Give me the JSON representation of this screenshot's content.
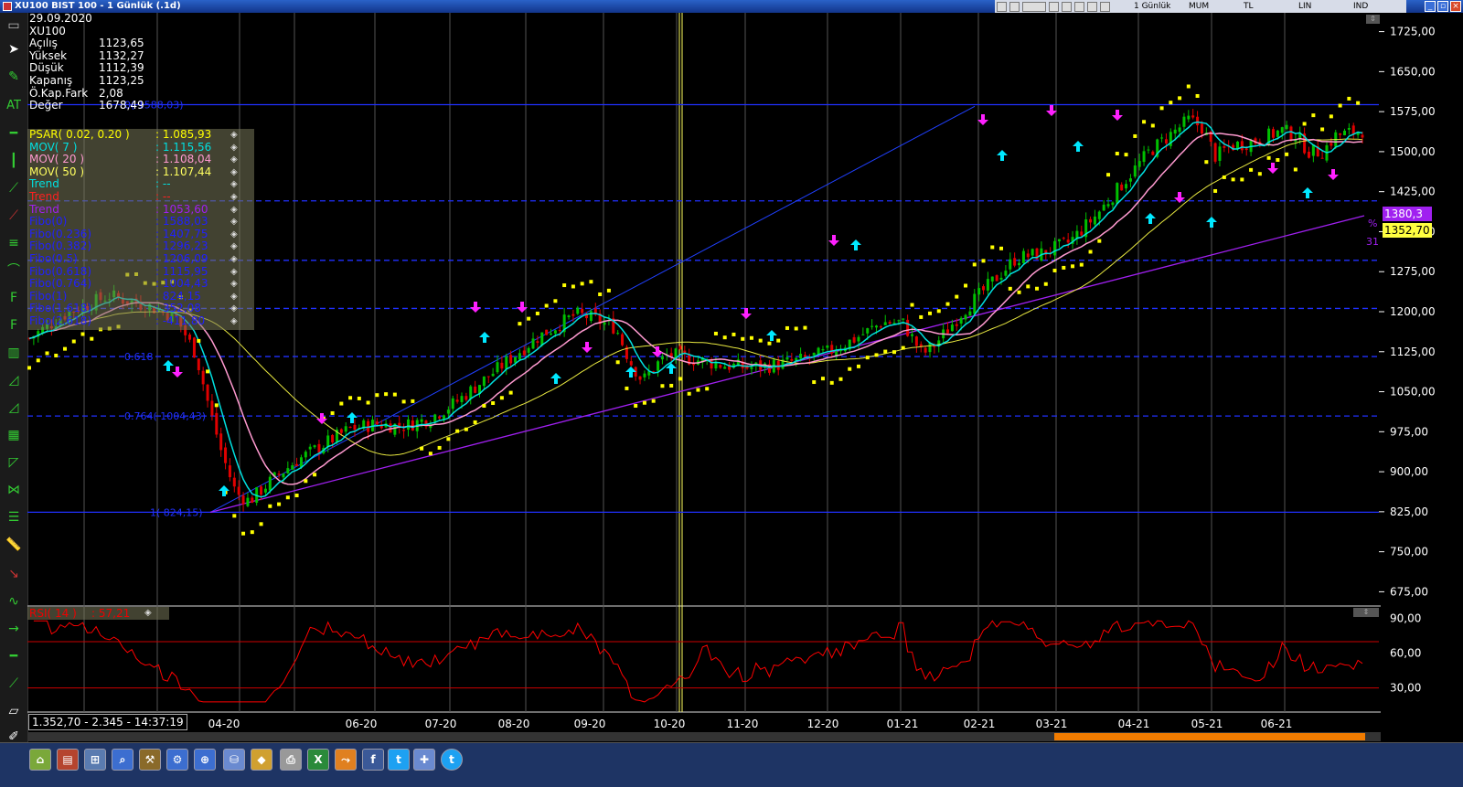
{
  "window": {
    "title": "XU100 BIST 100 - 1 Günlük (.1d)",
    "toolbar_labels": [
      "1 Günlük",
      "MUM",
      "TL",
      "LIN",
      "IND"
    ],
    "buttons": {
      "minimize": "_",
      "restore": "▫",
      "close": "×"
    }
  },
  "info": {
    "date": "29.09.2020",
    "symbol": "XU100",
    "rows": [
      {
        "label": "Açılış",
        "value": "1123,65"
      },
      {
        "label": "Yüksek",
        "value": "1132,27"
      },
      {
        "label": "Düşük",
        "value": "1112,39"
      },
      {
        "label": "Kapanış",
        "value": "1123,25"
      },
      {
        "label": "Ö.Kap.Fark",
        "value": "2,08"
      },
      {
        "label": "Değer",
        "value": "1678,49"
      }
    ]
  },
  "indicators": [
    {
      "name": "PSAR( 0.02, 0.20 )",
      "value": ": 1.085,93",
      "color": "#ffff00"
    },
    {
      "name": "MOV( 7 )",
      "value": ": 1.115,56",
      "color": "#00e0e0"
    },
    {
      "name": "MOV( 20 )",
      "value": ": 1.108,04",
      "color": "#ff9ad0"
    },
    {
      "name": "MOV( 50 )",
      "value": ": 1.107,44",
      "color": "#ffff60"
    },
    {
      "name": "Trend",
      "value": ": --",
      "color": "#00e0e0"
    },
    {
      "name": "Trend",
      "value": ": --",
      "color": "#ff2020"
    },
    {
      "name": "Trend",
      "value": ": 1053,60",
      "color": "#a020f0"
    },
    {
      "name": "Fibo(0)",
      "value": ": 1588,03",
      "color": "#2020ff"
    },
    {
      "name": "Fibo(0.236)",
      "value": ": 1407,75",
      "color": "#2020ff"
    },
    {
      "name": "Fibo(0.382)",
      "value": ": 1296,23",
      "color": "#2020ff"
    },
    {
      "name": "Fibo(0.5)",
      "value": ": 1206,09",
      "color": "#2020ff"
    },
    {
      "name": "Fibo(0.618)",
      "value": ": 1115,95",
      "color": "#2020ff"
    },
    {
      "name": "Fibo(0.764)",
      "value": ": 1004,43",
      "color": "#2020ff"
    },
    {
      "name": "Fibo(1)",
      "value": ": 824,15",
      "color": "#2020ff"
    },
    {
      "name": "Fibo(1.618)",
      "value": ": 352,08",
      "color": "#2020ff"
    },
    {
      "name": "Fibo(2.618)",
      "value": ": -411,80",
      "color": "#2020ff"
    }
  ],
  "fibo_labels": [
    {
      "text": "0( 1588,03)",
      "value": 1588.03
    },
    {
      "text": "0.764( 1004,43)",
      "value": 1004.43
    },
    {
      "text": "0.618",
      "value": 1115.95
    },
    {
      "text": "1( 824,15)",
      "value": 824.15
    }
  ],
  "y_axis": [
    "1725,00",
    "1650,00",
    "1575,00",
    "1500,00",
    "1425,00",
    "1350,00",
    "1275,00",
    "1200,00",
    "1125,00",
    "1050,00",
    "975,00",
    "900,00",
    "825,00",
    "750,00",
    "675,00"
  ],
  "y_values": [
    1725,
    1650,
    1575,
    1500,
    1425,
    1350,
    1275,
    1200,
    1125,
    1050,
    975,
    900,
    825,
    750,
    675
  ],
  "rsi": {
    "label": "RSI( 14 )",
    "value": ": 57,21",
    "axis": [
      "90,00",
      "60,00",
      "30,00"
    ],
    "axis_values": [
      90,
      60,
      30
    ]
  },
  "price_tags": {
    "trend_value": "1380,3",
    "last_price": "1352,70",
    "trend_right": "%",
    "trend_right2": "31"
  },
  "status": "1.352,70 - 2.345 - 14:37:19",
  "x_labels": [
    "04-20",
    "06-20",
    "07-20",
    "08-20",
    "09-20",
    "10-20",
    "11-20",
    "12-20",
    "01-21",
    "02-21",
    "03-21",
    "04-21",
    "05-21",
    "06-21"
  ],
  "colors": {
    "up": "#00c000",
    "down": "#e00000",
    "psar": "#ffff00",
    "mov7": "#00e0e0",
    "mov20": "#ff9ad0",
    "mov50": "#e8e840",
    "fibo": "#2030ff",
    "trend": "#a020f0",
    "rsi": "#ff0000"
  },
  "chart_data": {
    "type": "candlestick",
    "price_range": [
      650,
      1750
    ],
    "rsi_range": [
      10,
      100
    ],
    "fibo_levels": [
      1588.03,
      1407.75,
      1296.23,
      1206.09,
      1115.95,
      1004.43,
      824.15
    ],
    "close_path": [
      [
        0,
        1150
      ],
      [
        0.03,
        1200
      ],
      [
        0.06,
        1230
      ],
      [
        0.09,
        1210
      ],
      [
        0.11,
        1190
      ],
      [
        0.125,
        1120
      ],
      [
        0.135,
        1020
      ],
      [
        0.145,
        930
      ],
      [
        0.155,
        860
      ],
      [
        0.165,
        845
      ],
      [
        0.18,
        880
      ],
      [
        0.2,
        920
      ],
      [
        0.22,
        950
      ],
      [
        0.24,
        980
      ],
      [
        0.26,
        990
      ],
      [
        0.28,
        985
      ],
      [
        0.3,
        1000
      ],
      [
        0.32,
        1030
      ],
      [
        0.34,
        1070
      ],
      [
        0.36,
        1110
      ],
      [
        0.38,
        1150
      ],
      [
        0.4,
        1180
      ],
      [
        0.41,
        1195
      ],
      [
        0.42,
        1190
      ],
      [
        0.43,
        1180
      ],
      [
        0.44,
        1170
      ],
      [
        0.45,
        1110
      ],
      [
        0.46,
        1070
      ],
      [
        0.47,
        1100
      ],
      [
        0.48,
        1120
      ],
      [
        0.5,
        1110
      ],
      [
        0.52,
        1100
      ],
      [
        0.54,
        1095
      ],
      [
        0.56,
        1100
      ],
      [
        0.58,
        1110
      ],
      [
        0.6,
        1125
      ],
      [
        0.62,
        1150
      ],
      [
        0.64,
        1180
      ],
      [
        0.655,
        1180
      ],
      [
        0.67,
        1120
      ],
      [
        0.68,
        1140
      ],
      [
        0.7,
        1200
      ],
      [
        0.72,
        1250
      ],
      [
        0.74,
        1300
      ],
      [
        0.76,
        1310
      ],
      [
        0.78,
        1330
      ],
      [
        0.8,
        1380
      ],
      [
        0.82,
        1440
      ],
      [
        0.84,
        1500
      ],
      [
        0.86,
        1540
      ],
      [
        0.87,
        1560
      ],
      [
        0.88,
        1545
      ],
      [
        0.89,
        1490
      ],
      [
        0.9,
        1510
      ],
      [
        0.92,
        1520
      ],
      [
        0.94,
        1540
      ],
      [
        0.95,
        1530
      ],
      [
        0.96,
        1500
      ],
      [
        0.97,
        1500
      ],
      [
        0.98,
        1530
      ],
      [
        1.0,
        1540
      ]
    ]
  }
}
